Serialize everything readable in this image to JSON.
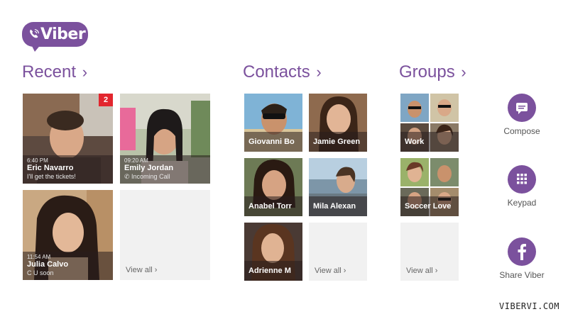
{
  "app": {
    "brand": "Viber",
    "accent": "#7b519d"
  },
  "recent": {
    "title": "Recent",
    "chevron": "›",
    "items": [
      {
        "time": "6:40 PM",
        "name": "Eric Navarro",
        "message": "I'll get the tickets!",
        "badge": "2"
      },
      {
        "time": "09:20 AM",
        "name": "Emily Jordan",
        "message": "Incoming Call"
      },
      {
        "time": "11:54 AM",
        "name": "Julia Calvo",
        "message": "C U soon"
      }
    ],
    "view_all": "View all ›"
  },
  "contacts": {
    "title": "Contacts",
    "chevron": "›",
    "items": [
      {
        "name": "Giovanni Bo"
      },
      {
        "name": "Jamie Green"
      },
      {
        "name": "Anabel Torr"
      },
      {
        "name": "Mila Alexan"
      },
      {
        "name": "Adrienne M"
      }
    ],
    "view_all": "View all ›"
  },
  "groups": {
    "title": "Groups",
    "chevron": "›",
    "items": [
      {
        "name": "Work"
      },
      {
        "name": "Soccer Love"
      }
    ],
    "view_all": "View all ›"
  },
  "actions": {
    "compose": {
      "label": "Compose",
      "icon": "compose-icon"
    },
    "keypad": {
      "label": "Keypad",
      "icon": "keypad-icon"
    },
    "share": {
      "label": "Share Viber",
      "icon": "facebook-icon"
    }
  },
  "watermark": "VIBERVI.COM"
}
